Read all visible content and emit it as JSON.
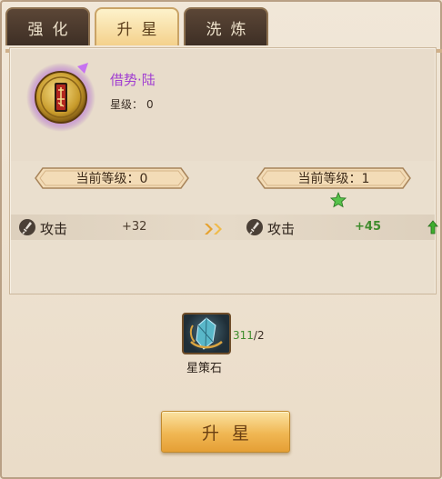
{
  "tabs": [
    {
      "label": "强化",
      "active": false
    },
    {
      "label": "升星",
      "active": true
    },
    {
      "label": "洗炼",
      "active": false
    }
  ],
  "item": {
    "name": "借势·陆",
    "star_level_label": "星级：",
    "star_level_value": "0",
    "emblem_icon": "talisman-seal-icon",
    "emblem_glow": "#b05ee0"
  },
  "levels": {
    "current_label": "当前等级：0",
    "next_label": "当前等级：1",
    "star_icon": "green-star-icon"
  },
  "stats": {
    "current": {
      "label": "攻击",
      "value": "+32",
      "icon": "sword-icon"
    },
    "arrow_icon": "double-chevron-right-icon",
    "next": {
      "label": "攻击",
      "value": "+45",
      "icon": "sword-icon",
      "indicator": "up-arrow-icon"
    }
  },
  "material": {
    "name": "星策石",
    "owned": "311",
    "required": "/2",
    "icon": "star-strategy-stone-icon"
  },
  "actions": {
    "upgrade_label": "升星"
  },
  "colors": {
    "accent_purple": "#a13fd1",
    "positive_green": "#3f8c2d",
    "button_gold": "#f0b753"
  }
}
